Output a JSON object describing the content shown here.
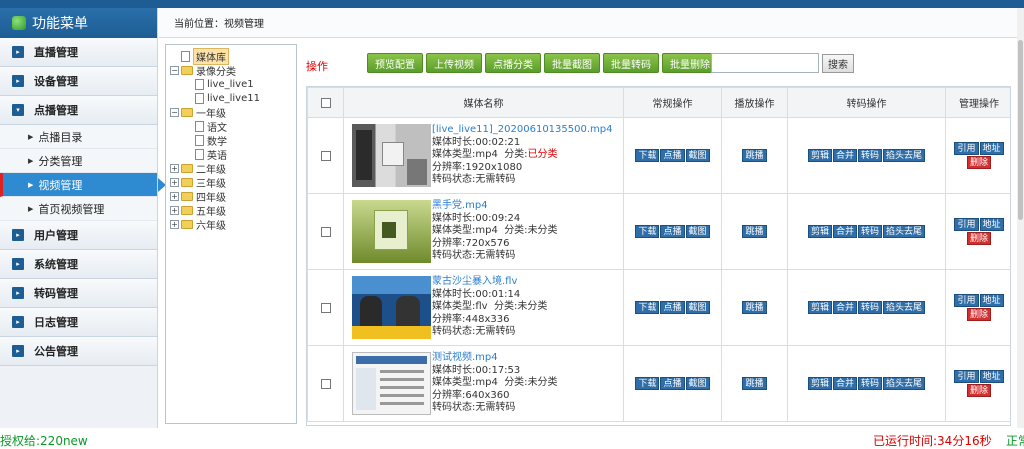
{
  "sidebar": {
    "title": "功能菜单",
    "groups": [
      {
        "label": "直播管理",
        "toggle": "▸"
      },
      {
        "label": "设备管理",
        "toggle": "▸"
      },
      {
        "label": "点播管理",
        "toggle": "▾"
      }
    ],
    "sub_items": [
      "点播目录",
      "分类管理",
      "视频管理",
      "首页视频管理"
    ],
    "groups_after": [
      "用户管理",
      "系统管理",
      "转码管理",
      "日志管理",
      "公告管理"
    ]
  },
  "breadcrumb": "当前位置：视频管理",
  "tree": {
    "root": "媒体库",
    "recording": "录像分类",
    "live1": "live_live1",
    "live11": "live_live11",
    "grade1": "一年级",
    "chinese": "语文",
    "math": "数学",
    "english": "英语",
    "grades": [
      "二年级",
      "三年级",
      "四年级",
      "五年级",
      "六年级"
    ]
  },
  "toolbar": {
    "op_label": "操作",
    "buttons": [
      "预览配置",
      "上传视频",
      "点播分类",
      "批量截图",
      "批量转码",
      "批量删除"
    ],
    "search_label": "搜索"
  },
  "table": {
    "headers": [
      "媒体名称",
      "常规操作",
      "播放操作",
      "转码操作",
      "管理操作"
    ],
    "ops": {
      "download": "下载",
      "vod": "点播",
      "screenshot": "截图",
      "jump": "跳播",
      "cut": "剪辑",
      "merge": "合并",
      "transcode": "转码",
      "trim": "掐头去尾",
      "cite": "引用",
      "address": "地址",
      "delete": "删除"
    },
    "rows": [
      {
        "title": "[live_live11]_20200610135500.mp4",
        "duration": "媒体时长:00:02:21",
        "type": "媒体类型:mp4",
        "category_label": "分类:",
        "category": "已分类",
        "category_red": true,
        "resolution": "分辨率:1920x1080",
        "status": "转码状态:无需转码"
      },
      {
        "title": "黑手党.mp4",
        "duration": "媒体时长:00:09:24",
        "type": "媒体类型:mp4",
        "category_label": "分类:",
        "category": "未分类",
        "category_red": false,
        "resolution": "分辨率:720x576",
        "status": "转码状态:无需转码"
      },
      {
        "title": "蒙古沙尘暴入境.flv",
        "duration": "媒体时长:00:01:14",
        "type": "媒体类型:flv",
        "category_label": "分类:",
        "category": "未分类",
        "category_red": false,
        "resolution": "分辨率:448x336",
        "status": "转码状态:无需转码"
      },
      {
        "title": "测试视频.mp4",
        "duration": "媒体时长:00:17:53",
        "type": "媒体类型:mp4",
        "category_label": "分类:",
        "category": "未分类",
        "category_red": false,
        "resolution": "分辨率:640x360",
        "status": "转码状态:无需转码"
      }
    ]
  },
  "status": {
    "license": "授权给:220new",
    "uptime": "已运行时间:34分16秒",
    "cut": "正常"
  },
  "colors": {
    "header_blue": "#1d5d94",
    "active_blue": "#2f8bd1",
    "green_btn": "#6aab37",
    "op_blue": "#2f6ea8",
    "delete_red": "#d32f2f"
  }
}
